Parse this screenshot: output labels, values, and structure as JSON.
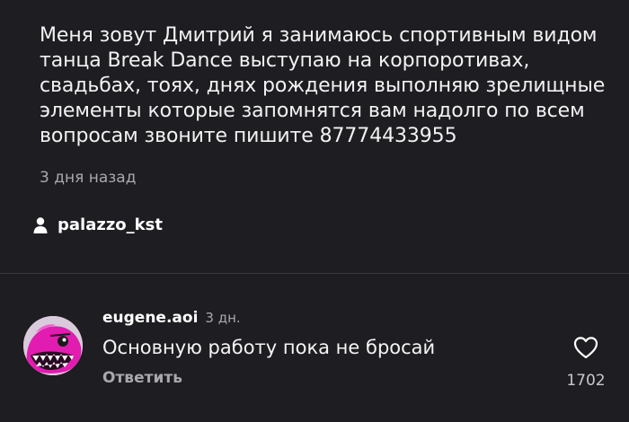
{
  "post": {
    "description": "Меня зовут Дмитрий я занимаюсь спортивным видом\nтанца Break Dance выступаю на корпоротивах,\nсвадьбах, тоях, днях рождения выполняю зрелищные\nэлементы которые запомнятся вам надолго  по всем\nвопросам звоните пишите 87774433955",
    "timestamp": "3 дня назад",
    "author": "palazzo_kst"
  },
  "comment": {
    "username": "eugene.aoi",
    "time": "3 дн.",
    "text": "Основную работу пока не бросай",
    "reply_label": "Ответить",
    "like_count": "1702",
    "avatar_icon": "pink-shark-avatar",
    "like_icon": "heart-outline-icon"
  },
  "colors": {
    "background": "#1e1d21",
    "text_primary": "#f2f2f2",
    "text_secondary": "#a8a8ad",
    "divider": "#38373c",
    "avatar_accent": "#e020b0"
  }
}
